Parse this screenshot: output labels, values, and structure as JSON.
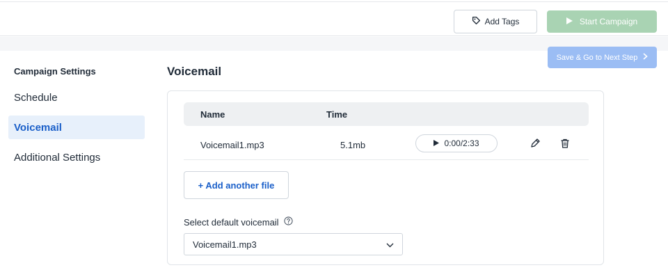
{
  "header": {
    "add_tags_label": "Add Tags",
    "start_campaign_label": "Start Campaign"
  },
  "next_step_label": "Save & Go to Next Step",
  "sidebar": {
    "title": "Campaign Settings",
    "items": [
      {
        "label": "Schedule",
        "active": false
      },
      {
        "label": "Voicemail",
        "active": true
      },
      {
        "label": "Additional Settings",
        "active": false
      }
    ]
  },
  "main": {
    "title": "Voicemail",
    "table": {
      "columns": [
        "Name",
        "Time"
      ],
      "rows": [
        {
          "name": "Voicemail1.mp3",
          "size": "5.1mb",
          "playback": "0:00/2:33"
        }
      ]
    },
    "add_file_label": "+ Add another file",
    "default_voicemail": {
      "label": "Select default voicemail",
      "selected": "Voicemail1.mp3"
    }
  },
  "colors": {
    "accent": "#1a5fc9",
    "start_button": "#a9d3b3",
    "next_button": "#9bbdf4",
    "active_item_bg": "#e7f0fb"
  },
  "icons": {
    "tag": "tag-icon",
    "play": "play-icon",
    "chevron_right": "chevron-right-icon",
    "edit": "pencil-icon",
    "delete": "trash-icon",
    "help": "question-circle-icon",
    "dropdown": "chevron-down-icon"
  }
}
